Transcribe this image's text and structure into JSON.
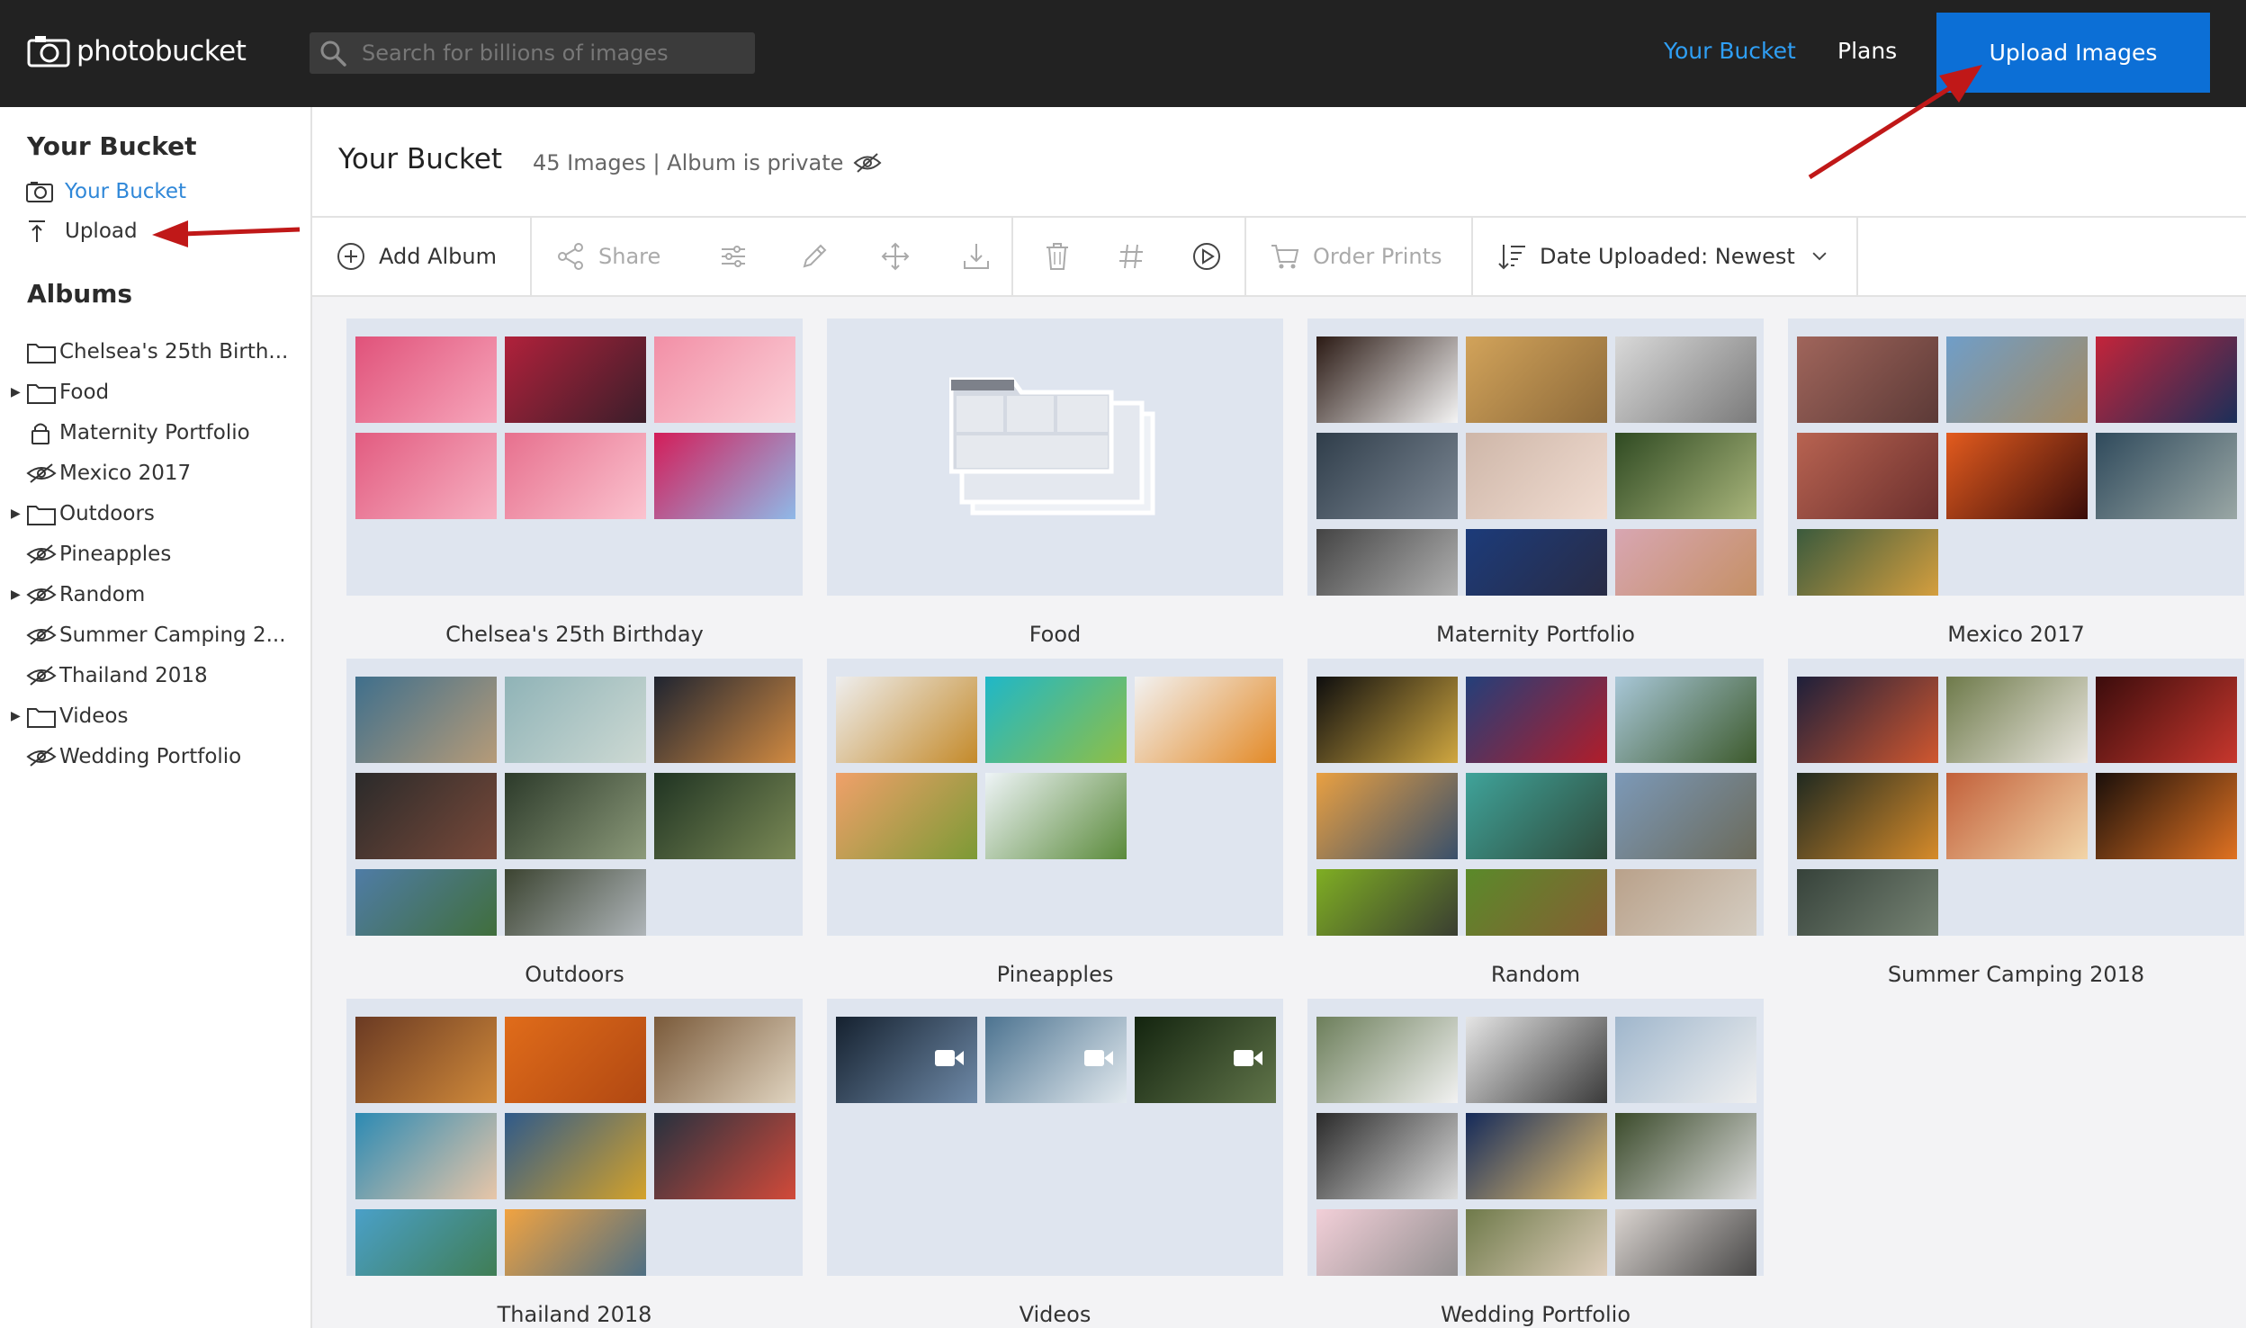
{
  "header": {
    "logo_text": "photobucket",
    "search_placeholder": "Search for billions of images",
    "nav_bucket": "Your Bucket",
    "nav_plans": "Plans",
    "upload_button": "Upload Images"
  },
  "sidebar": {
    "section_title": "Your Bucket",
    "link_bucket": "Your Bucket",
    "link_upload": "Upload",
    "albums_title": "Albums",
    "albums": [
      {
        "label": "Chelsea's 25th Birth...",
        "icon": "folder-icon",
        "expandable": false
      },
      {
        "label": "Food",
        "icon": "folder-icon",
        "expandable": true
      },
      {
        "label": "Maternity Portfolio",
        "icon": "lock-icon",
        "expandable": false
      },
      {
        "label": "Mexico 2017",
        "icon": "eye-slash-icon",
        "expandable": false
      },
      {
        "label": "Outdoors",
        "icon": "folder-icon",
        "expandable": true
      },
      {
        "label": "Pineapples",
        "icon": "eye-slash-icon",
        "expandable": false
      },
      {
        "label": "Random",
        "icon": "eye-slash-icon",
        "expandable": true
      },
      {
        "label": "Summer Camping 2...",
        "icon": "eye-slash-icon",
        "expandable": false
      },
      {
        "label": "Thailand 2018",
        "icon": "eye-slash-icon",
        "expandable": false
      },
      {
        "label": "Videos",
        "icon": "folder-icon",
        "expandable": true
      },
      {
        "label": "Wedding Portfolio",
        "icon": "eye-slash-icon",
        "expandable": false
      }
    ]
  },
  "main": {
    "title": "Your Bucket",
    "info": "45 Images | Album is private"
  },
  "toolbar": {
    "add_album": "Add Album",
    "share": "Share",
    "order_prints": "Order Prints",
    "sort": "Date Uploaded: Newest"
  },
  "albums_grid": [
    {
      "name": "Chelsea's 25th Birthday",
      "empty": false,
      "thumbs": [
        [
          "#e0527a",
          "#f7a6bb"
        ],
        [
          "#b1213b",
          "#3a1e2a"
        ],
        [
          "#f28fa6",
          "#fbd0d8"
        ],
        [
          "#e25b80",
          "#f7b1c2"
        ],
        [
          "#e7708e",
          "#fbc3cf"
        ],
        [
          "#d31d59",
          "#8fb9e8"
        ]
      ]
    },
    {
      "name": "Food",
      "empty": true,
      "thumbs": []
    },
    {
      "name": "Maternity Portfolio",
      "empty": false,
      "thumbs": [
        [
          "#2b1a14",
          "#f4f4f4"
        ],
        [
          "#d2a35a",
          "#8d6a3a"
        ],
        [
          "#d9d9d9",
          "#7a7a7a"
        ],
        [
          "#2f3d4a",
          "#7d8894"
        ],
        [
          "#ceb6a8",
          "#f1ddd2"
        ],
        [
          "#2f4a22",
          "#aab67c"
        ],
        [
          "#444444",
          "#bbbbbb"
        ],
        [
          "#1c3b7a",
          "#2a2a40"
        ],
        [
          "#d8a6b2",
          "#c38e5e"
        ]
      ]
    },
    {
      "name": "Mexico 2017",
      "empty": false,
      "thumbs": [
        [
          "#a0655b",
          "#5c3a37"
        ],
        [
          "#6f9ec9",
          "#a58a60"
        ],
        [
          "#c4243a",
          "#1b2f59"
        ],
        [
          "#b86351",
          "#6a2f2d"
        ],
        [
          "#e35b1e",
          "#3a0d0a"
        ],
        [
          "#2f4a5c",
          "#9aa7a5"
        ],
        [
          "#3a5a3d",
          "#e3a53f"
        ]
      ]
    },
    {
      "name": "Outdoors",
      "empty": false,
      "thumbs": [
        [
          "#3f6f8c",
          "#b69b78"
        ],
        [
          "#8fb3b7",
          "#cdd9d3"
        ],
        [
          "#1f2430",
          "#d18a41"
        ],
        [
          "#2a2a2a",
          "#7a4a3a"
        ],
        [
          "#2c3a2a",
          "#8c9a7a"
        ],
        [
          "#1f3322",
          "#7b8a56"
        ],
        [
          "#4f7ca6",
          "#3f6d32"
        ],
        [
          "#3c4431",
          "#bac0c6"
        ]
      ]
    },
    {
      "name": "Pineapples",
      "empty": false,
      "thumbs": [
        [
          "#eeeeee",
          "#c48a2a"
        ],
        [
          "#1fb7c8",
          "#8fbf45"
        ],
        [
          "#f2f2f2",
          "#e38a27"
        ],
        [
          "#f0a06a",
          "#7c9a35"
        ],
        [
          "#eef4f7",
          "#5a8a3a"
        ]
      ]
    },
    {
      "name": "Random",
      "empty": false,
      "thumbs": [
        [
          "#0e0e0e",
          "#d0a740"
        ],
        [
          "#233f7a",
          "#b11d2a"
        ],
        [
          "#a8c7d8",
          "#3d5a2c"
        ],
        [
          "#e9a042",
          "#39506b"
        ],
        [
          "#3fa39a",
          "#2f4a3a"
        ],
        [
          "#7c99b8",
          "#6b6a5a"
        ],
        [
          "#7fae23",
          "#333333"
        ],
        [
          "#5a8a2a",
          "#8a5a34"
        ],
        [
          "#b9a18a",
          "#d8d2c8"
        ]
      ]
    },
    {
      "name": "Summer Camping 2018",
      "empty": false,
      "thumbs": [
        [
          "#1d1f3a",
          "#d0572f"
        ],
        [
          "#6e7a4a",
          "#ebe7e0"
        ],
        [
          "#3b0c0c",
          "#c7372d"
        ],
        [
          "#1f2920",
          "#d68b2a"
        ],
        [
          "#c2603a",
          "#f2d5a8"
        ],
        [
          "#1a0f0a",
          "#e07222"
        ],
        [
          "#36423a",
          "#7d8a7a"
        ]
      ]
    },
    {
      "name": "Thailand 2018",
      "empty": false,
      "thumbs": [
        [
          "#6a3a23",
          "#d18a3a"
        ],
        [
          "#e06c1a",
          "#b14812"
        ],
        [
          "#7a5a3a",
          "#e0d4c0"
        ],
        [
          "#2c8ab3",
          "#e8c6a8"
        ],
        [
          "#2f5a8a",
          "#d4a22a"
        ],
        [
          "#26313f",
          "#d24a3a"
        ],
        [
          "#4aa0c8",
          "#3f7a4a"
        ],
        [
          "#f1a341",
          "#3f6a8a"
        ]
      ]
    },
    {
      "name": "Videos",
      "empty": false,
      "video": true,
      "thumbs": [
        [
          "#15212f",
          "#6f8aa8"
        ],
        [
          "#4c7390",
          "#e3eaef"
        ],
        [
          "#13240f",
          "#61754a"
        ]
      ]
    },
    {
      "name": "Wedding Portfolio",
      "empty": false,
      "thumbs": [
        [
          "#6c7e5a",
          "#f2f2f2"
        ],
        [
          "#e5e5e5",
          "#3a3a3a"
        ],
        [
          "#9fb6cc",
          "#f0f0f0"
        ],
        [
          "#2a2a2a",
          "#dcdcdc"
        ],
        [
          "#142a5a",
          "#e8c270"
        ],
        [
          "#3a4a2a",
          "#dcdcdc"
        ],
        [
          "#f2cfd8",
          "#8a8a8a"
        ],
        [
          "#6f7a4a",
          "#e9d6c6"
        ],
        [
          "#dad4d0",
          "#3a3a3a"
        ]
      ]
    }
  ],
  "colors": {
    "topbar": "#222222",
    "accent_blue": "#2f9ff5",
    "upload_blue": "#0c6fd6",
    "annotation_red": "#c01818"
  }
}
